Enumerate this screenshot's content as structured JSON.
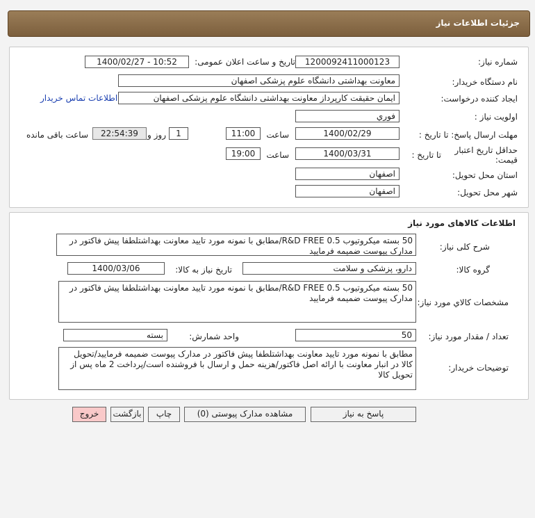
{
  "header": {
    "title": "جزئیات اطلاعات نیاز"
  },
  "need_info": {
    "need_number_label": "شماره نیاز:",
    "need_number": "1200092411000123",
    "announce_label": "تاریخ و ساعت اعلان عمومی:",
    "announce_value": "1400/02/27 - 10:52",
    "buyer_label": "نام دستگاه خریدار:",
    "buyer_value": "معاونت بهداشتی دانشگاه علوم پزشکی اصفهان",
    "creator_label": "ایجاد کننده درخواست:",
    "creator_value": "ایمان حقیقت کارپرداز معاونت بهداشتی دانشگاه علوم پزشکی اصفهان",
    "contact_link": "اطلاعات تماس خریدار",
    "priority_label": "اولویت نیاز :",
    "priority_value": "فوري",
    "deadline_label": "مهلت ارسال پاسخ: تا تاریخ :",
    "deadline_date": "1400/02/29",
    "time_label": "ساعت",
    "deadline_time": "11:00",
    "days_value": "1",
    "days_label": "روز و",
    "remaining_time": "22:54:39",
    "remaining_label": "ساعت باقی مانده",
    "validity_label": "حداقل تاریخ اعتبار قیمت:",
    "validity_to_label": "تا تاریخ :",
    "validity_date": "1400/03/31",
    "validity_time_label": "ساعت",
    "validity_time": "19:00",
    "province_label": "استان محل تحویل:",
    "province_value": "اصفهان",
    "city_label": "شهر محل تحویل:",
    "city_value": "اصفهان"
  },
  "goods": {
    "title": "اطلاعات کالاهای مورد نیاز",
    "general_desc_label": "شرح کلی نیاز:",
    "general_desc": "50 بسته میکروتیوب R&D FREE 0.5/مطابق با نمونه مورد تایید معاونت بهداشتلطفا پیش فاکتور در مدارک پیوست ضمیمه فرمایید",
    "group_label": "گروه کالا:",
    "group_value": "دارو، پزشکی و سلامت",
    "need_date_label": "تاریخ نیاز به کالا:",
    "need_date": "1400/03/06",
    "spec_label": "مشخصات کالاي مورد نیاز:",
    "spec_value": "50 بسته میکروتیوب R&D FREE 0.5/مطابق با نمونه مورد تایید معاونت بهداشتلطفا پیش فاکتور در مدارک پیوست ضمیمه فرمایید",
    "qty_label": "تعداد / مقدار مورد نیاز:",
    "qty_value": "50",
    "unit_label": "واحد شمارش:",
    "unit_value": "بسته",
    "buyer_notes_label": "توضیحات خریدار:",
    "buyer_notes": "مطابق با نمونه مورد تایید معاونت بهداشتلطفا پیش فاکتور در مدارک پیوست ضمیمه فرمایید/تحویل کالا در انبار معاونت با ارائه اصل فاکتور/هزینه حمل و ارسال با فروشنده است/پرداخت 2 ماه پس از تحویل کالا"
  },
  "buttons": {
    "reply": "پاسخ به نیاز",
    "attachments": "مشاهده مدارک پیوستی (0)",
    "print": "چاپ",
    "back": "بازگشت",
    "exit": "خروج"
  },
  "colors": {
    "header_bg": "#8b6c47",
    "exit_bg": "#f9c9c9",
    "link": "#1a3fb0"
  }
}
